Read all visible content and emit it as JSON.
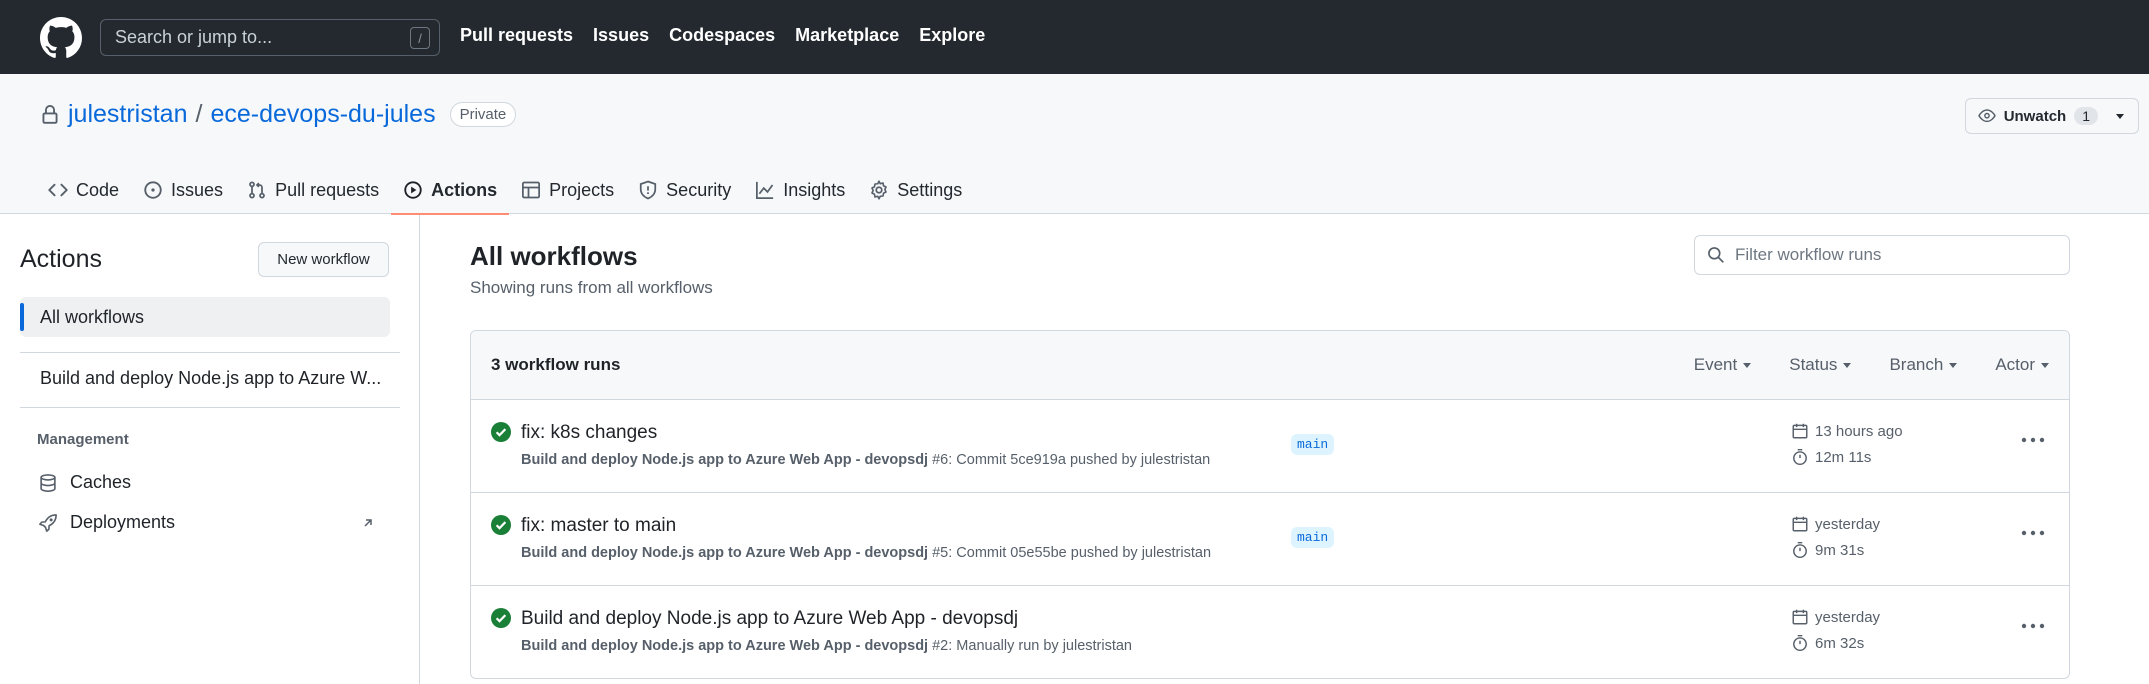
{
  "header": {
    "search_placeholder": "Search or jump to...",
    "search_shortcut": "/",
    "nav": [
      "Pull requests",
      "Issues",
      "Codespaces",
      "Marketplace",
      "Explore"
    ]
  },
  "repo": {
    "owner": "julestristan",
    "separator": "/",
    "name": "ece-devops-du-jules",
    "visibility": "Private",
    "unwatch_label": "Unwatch",
    "watch_count": "1",
    "tabs": [
      "Code",
      "Issues",
      "Pull requests",
      "Actions",
      "Projects",
      "Security",
      "Insights",
      "Settings"
    ],
    "active_tab": "Actions"
  },
  "sidebar": {
    "title": "Actions",
    "new_workflow": "New workflow",
    "all_workflows": "All workflows",
    "workflow": "Build and deploy Node.js app to Azure W...",
    "management_heading": "Management",
    "management_items": [
      "Caches",
      "Deployments"
    ]
  },
  "main": {
    "title": "All workflows",
    "subtitle": "Showing runs from all workflows",
    "filter_placeholder": "Filter workflow runs",
    "runs_count": "3 workflow runs",
    "filters": [
      "Event",
      "Status",
      "Branch",
      "Actor"
    ],
    "runs": [
      {
        "title": "fix: k8s changes",
        "workflow": "Build and deploy Node.js app to Azure Web App - devopsdj",
        "detail": " #6: Commit 5ce919a pushed by julestristan",
        "branch": "main",
        "when": "13 hours ago",
        "duration": "12m 11s",
        "status": "success"
      },
      {
        "title": "fix: master to main",
        "workflow": "Build and deploy Node.js app to Azure Web App - devopsdj",
        "detail": " #5: Commit 05e55be pushed by julestristan",
        "branch": "main",
        "when": "yesterday",
        "duration": "9m 31s",
        "status": "success"
      },
      {
        "title": "Build and deploy Node.js app to Azure Web App - devopsdj",
        "workflow": "Build and deploy Node.js app to Azure Web App - devopsdj",
        "detail": " #2: Manually run by julestristan",
        "branch": "",
        "when": "yesterday",
        "duration": "6m 32s",
        "status": "success"
      }
    ]
  },
  "colors": {
    "header_bg": "#24292f",
    "link": "#0969da",
    "active_tab_underline": "#fd8c73",
    "success": "#1a7f37",
    "branch_bg": "#ddf4ff"
  }
}
